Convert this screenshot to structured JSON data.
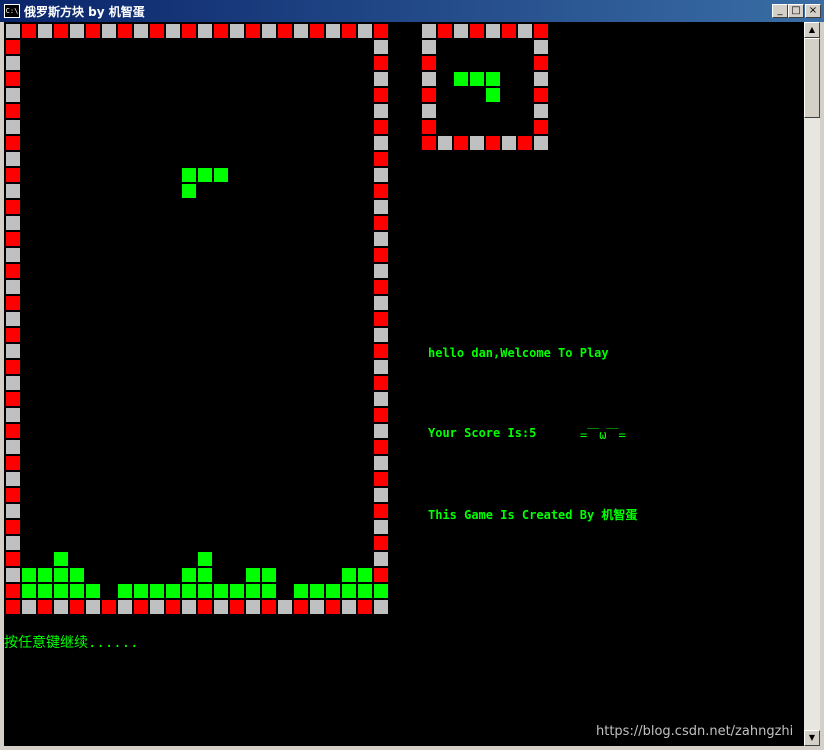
{
  "window": {
    "title": "俄罗斯方块 by 机智蛋",
    "icon_label": "C:\\",
    "minimize_label": "_",
    "maximize_label": "□",
    "close_label": "×"
  },
  "colors": {
    "background": "#000000",
    "block": "#00ff00",
    "border_red": "#ff0000",
    "border_gray": "#c0c0c0",
    "text": "#00ff00"
  },
  "game": {
    "board": {
      "width": 24,
      "height": 37,
      "border_pattern": [
        "gray",
        "red"
      ],
      "settled_rows": [
        ".........",
        "...x..........x..............",
        "................................................"
      ],
      "stack": {
        "row_34": [
          3,
          12
        ],
        "row_35": [
          1,
          2,
          3,
          4,
          11,
          12,
          15,
          16,
          21,
          22
        ],
        "row_36": [
          1,
          2,
          3,
          4,
          5,
          7,
          8,
          9,
          10,
          11,
          12,
          13,
          14,
          15,
          16,
          18,
          19,
          20,
          21,
          22,
          23
        ]
      },
      "falling_piece": [
        [
          11,
          9
        ],
        [
          12,
          9
        ],
        [
          13,
          9
        ],
        [
          11,
          10
        ]
      ]
    },
    "preview": {
      "width": 8,
      "height": 8,
      "piece": [
        [
          2,
          3
        ],
        [
          3,
          3
        ],
        [
          4,
          3
        ],
        [
          4,
          4
        ]
      ]
    }
  },
  "messages": {
    "welcome": "hello dan,Welcome To Play",
    "score_label": "Your Score Is:",
    "score_value": "5",
    "emoticon": "=￣ω￣=",
    "credits": "This Game Is Created By 机智蛋",
    "continue_prompt": "按任意键继续......"
  },
  "watermark": "https://blog.csdn.net/zahngzhi"
}
